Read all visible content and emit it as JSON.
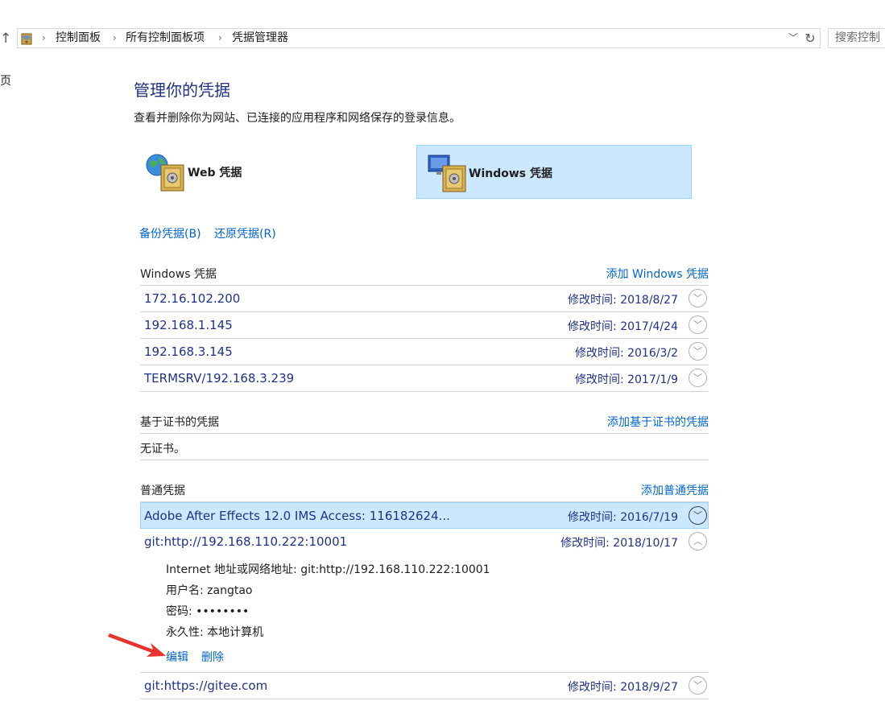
{
  "address_bar": {
    "crumbs": [
      "控制面板",
      "所有控制面板项",
      "凭据管理器"
    ],
    "search_placeholder": "搜索控制"
  },
  "side_fragment": "页",
  "header": {
    "title": "管理你的凭据",
    "description": "查看并删除你为网站、已连接的应用程序和网络保存的登录信息。"
  },
  "tiles": {
    "web_label": "Web 凭据",
    "windows_label": "Windows 凭据",
    "selected": "windows"
  },
  "actions": {
    "backup": "备份凭据(B)",
    "restore": "还原凭据(R)"
  },
  "windows_section": {
    "title": "Windows 凭据",
    "add": "添加 Windows 凭据",
    "items": [
      {
        "name": "172.16.102.200",
        "date": "修改时间:  2018/8/27"
      },
      {
        "name": "192.168.1.145",
        "date": "修改时间:  2017/4/24"
      },
      {
        "name": "192.168.3.145",
        "date": "修改时间:  2016/3/2"
      },
      {
        "name": "TERMSRV/192.168.3.239",
        "date": "修改时间:  2017/1/9"
      }
    ]
  },
  "cert_section": {
    "title": "基于证书的凭据",
    "add": "添加基于证书的凭据",
    "empty": "无证书。"
  },
  "generic_section": {
    "title": "普通凭据",
    "add": "添加普通凭据",
    "items": [
      {
        "name": "Adobe After Effects 12.0 IMS Access: 116182624...",
        "date": "修改时间:  2016/7/19"
      },
      {
        "name": "git:http://192.168.110.222:10001",
        "date": "修改时间:  2018/10/17"
      },
      {
        "name": "git:https://gitee.com",
        "date": "修改时间:  2018/9/27"
      }
    ],
    "expanded": {
      "address": "Internet 地址或网络地址:  git:http://192.168.110.222:10001",
      "username": "用户名:  zangtao",
      "password": "密码:  ••••••••",
      "persistence": "永久性:  本地计算机",
      "edit": "编辑",
      "delete": "删除"
    }
  },
  "colors": {
    "title_blue": "#1e3287",
    "link_blue": "#0066cc",
    "selection_bg": "#cce8ff",
    "annotation_arrow": "#e8322d"
  }
}
